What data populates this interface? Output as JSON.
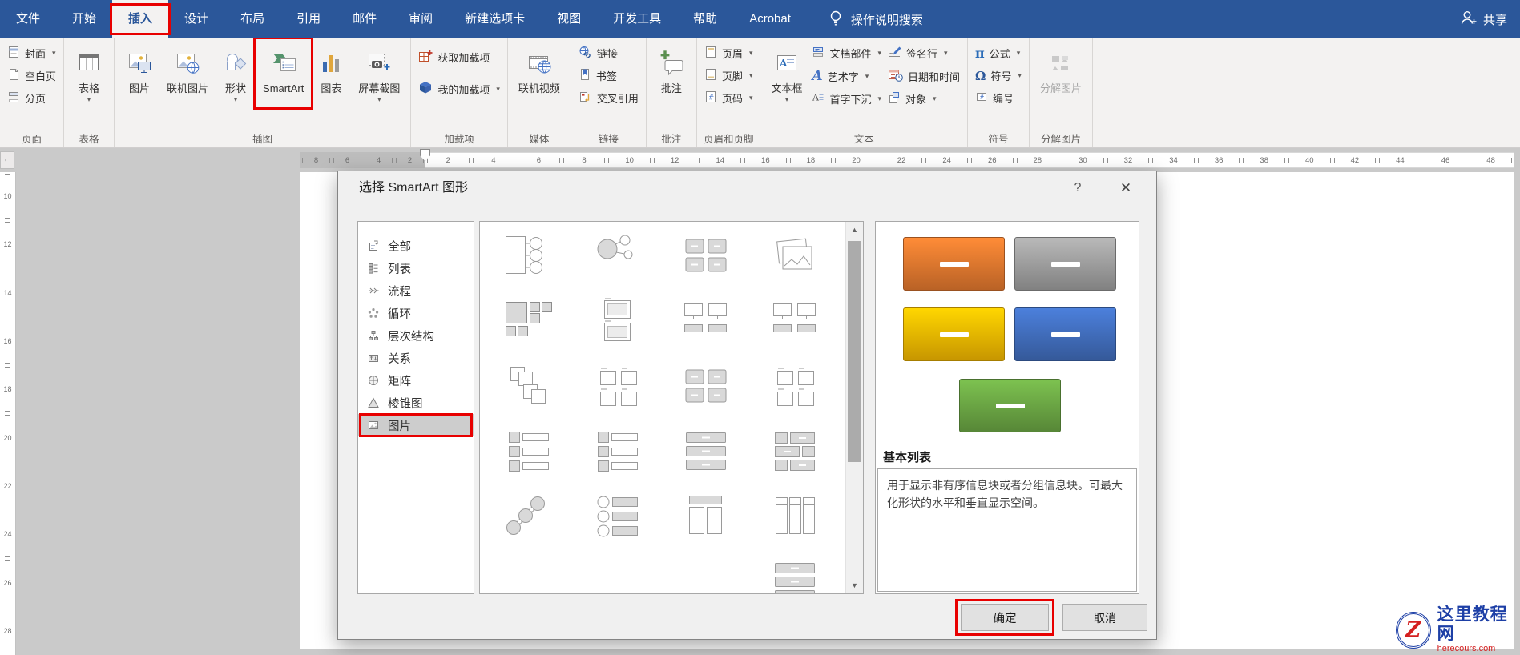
{
  "titlebar": {
    "tabs": [
      "文件",
      "开始",
      "插入",
      "设计",
      "布局",
      "引用",
      "邮件",
      "审阅",
      "新建选项卡",
      "视图",
      "开发工具",
      "帮助",
      "Acrobat"
    ],
    "active_tab": "插入",
    "search_label": "操作说明搜索",
    "share_label": "共享"
  },
  "ribbon": {
    "groups": [
      {
        "label": "页面",
        "blocks": [
          {
            "type": "stack",
            "items": [
              {
                "label": "封面",
                "icon": "cover-icon",
                "dd": true
              },
              {
                "label": "空白页",
                "icon": "blank-page-icon"
              },
              {
                "label": "分页",
                "icon": "page-break-icon"
              }
            ]
          }
        ]
      },
      {
        "label": "表格",
        "blocks": [
          {
            "type": "big",
            "items": [
              {
                "label": "表格",
                "icon": "table-icon",
                "dd": true
              }
            ]
          }
        ]
      },
      {
        "label": "插图",
        "blocks": [
          {
            "type": "big",
            "items": [
              {
                "label": "图片",
                "icon": "picture-icon"
              },
              {
                "label": "联机图片",
                "icon": "online-pictures-icon"
              },
              {
                "label": "形状",
                "icon": "shapes-icon",
                "dd": true
              },
              {
                "label": "SmartArt",
                "icon": "smartart-icon",
                "highlight": true
              },
              {
                "label": "图表",
                "icon": "chart-icon"
              },
              {
                "label": "屏幕截图",
                "icon": "screenshot-icon",
                "dd": true
              }
            ]
          }
        ]
      },
      {
        "label": "加载项",
        "blocks": [
          {
            "type": "stack",
            "loose": true,
            "items": [
              {
                "label": "获取加载项",
                "icon": "store-icon"
              },
              {
                "label": "我的加载项",
                "icon": "my-addins-icon",
                "dd": true
              }
            ]
          }
        ]
      },
      {
        "label": "媒体",
        "blocks": [
          {
            "type": "big",
            "items": [
              {
                "label": "联机视频",
                "icon": "online-video-icon"
              }
            ]
          }
        ]
      },
      {
        "label": "链接",
        "blocks": [
          {
            "type": "stack",
            "items": [
              {
                "label": "链接",
                "icon": "link-icon"
              },
              {
                "label": "书签",
                "icon": "bookmark-icon"
              },
              {
                "label": "交叉引用",
                "icon": "cross-reference-icon"
              }
            ]
          }
        ]
      },
      {
        "label": "批注",
        "blocks": [
          {
            "type": "big",
            "items": [
              {
                "label": "批注",
                "icon": "comment-icon"
              }
            ]
          }
        ]
      },
      {
        "label": "页眉和页脚",
        "blocks": [
          {
            "type": "stack",
            "items": [
              {
                "label": "页眉",
                "icon": "header-icon",
                "dd": true
              },
              {
                "label": "页脚",
                "icon": "footer-icon",
                "dd": true
              },
              {
                "label": "页码",
                "icon": "page-number-icon",
                "dd": true
              }
            ]
          }
        ]
      },
      {
        "label": "文本",
        "blocks": [
          {
            "type": "big",
            "items": [
              {
                "label": "文本框",
                "icon": "textbox-icon",
                "dd": true
              }
            ]
          },
          {
            "type": "stack",
            "items": [
              {
                "label": "文档部件",
                "icon": "quick-parts-icon",
                "dd": true
              },
              {
                "label": "艺术字",
                "icon": "wordart-icon",
                "dd": true
              },
              {
                "label": "首字下沉",
                "icon": "drop-cap-icon",
                "dd": true
              }
            ]
          },
          {
            "type": "stack",
            "items": [
              {
                "label": "签名行",
                "icon": "signature-line-icon",
                "dd": true
              },
              {
                "label": "日期和时间",
                "icon": "date-time-icon"
              },
              {
                "label": "对象",
                "icon": "object-icon",
                "dd": true
              }
            ]
          }
        ]
      },
      {
        "label": "符号",
        "blocks": [
          {
            "type": "stack",
            "items": [
              {
                "label": "公式",
                "icon": "equation-icon",
                "dd": true
              },
              {
                "label": "符号",
                "icon": "symbol-icon",
                "dd": true
              },
              {
                "label": "编号",
                "icon": "numbering-icon"
              }
            ]
          }
        ]
      },
      {
        "label": "分解图片",
        "blocks": [
          {
            "type": "big",
            "items": [
              {
                "label": "分解图片",
                "icon": "decompose-picture-icon",
                "disabled": true
              }
            ]
          }
        ]
      }
    ]
  },
  "ruler": {
    "h_margin_labels": [
      "8",
      "6",
      "4",
      "2"
    ],
    "h_labels": [
      "2",
      "4",
      "6",
      "8",
      "10",
      "12",
      "14",
      "16",
      "18",
      "20",
      "22",
      "24",
      "26",
      "28",
      "30",
      "32",
      "34",
      "36",
      "38",
      "40",
      "42",
      "44",
      "46",
      "48"
    ],
    "v_labels": [
      "10",
      "12",
      "14",
      "16",
      "18",
      "20",
      "22",
      "24",
      "26",
      "28"
    ]
  },
  "dialog": {
    "title": "选择 SmartArt 图形",
    "help_glyph": "?",
    "close_glyph": "✕",
    "categories": [
      {
        "label": "全部",
        "icon": "all-icon"
      },
      {
        "label": "列表",
        "icon": "list-category-icon"
      },
      {
        "label": "流程",
        "icon": "process-icon"
      },
      {
        "label": "循环",
        "icon": "cycle-icon"
      },
      {
        "label": "层次结构",
        "icon": "hierarchy-icon"
      },
      {
        "label": "关系",
        "icon": "relationship-icon"
      },
      {
        "label": "矩阵",
        "icon": "matrix-icon"
      },
      {
        "label": "棱锥图",
        "icon": "pyramid-icon"
      },
      {
        "label": "图片",
        "icon": "picture-category-icon",
        "selected": true,
        "highlight": true
      }
    ],
    "gallery_items": [
      "thumb-vertical-picture-list",
      "thumb-alternating-picture-circles",
      "thumb-picture-blocks",
      "thumb-stacked-pictures",
      "thumb-bending-picture-grid",
      "thumb-framed-pictures",
      "thumb-picture-screens",
      "thumb-picture-screens",
      "thumb-overlapping-pictures",
      "thumb-titled-pictures",
      "thumb-picture-blocks",
      "thumb-titled-pictures",
      "thumb-picture-caption-rows",
      "thumb-picture-caption-rows",
      "thumb-horizontal-bars",
      "thumb-bento-grid",
      "thumb-ascending-circles",
      "thumb-circle-caption-rows",
      "thumb-header-columns",
      "thumb-three-columns",
      "thumb-hex-partial",
      "thumb-dot-link-partial",
      "thumb-dot-link-partial",
      "thumb-horizontal-bars"
    ],
    "preview": {
      "shapes": [
        {
          "name": "orange",
          "color": "#ED7D31"
        },
        {
          "name": "gray",
          "color": "#A5A5A5"
        },
        {
          "name": "gold",
          "color": "#FFC000"
        },
        {
          "name": "blue",
          "color": "#4472C4"
        },
        {
          "name": "green",
          "color": "#70AD47"
        }
      ],
      "name": "基本列表",
      "description": "用于显示非有序信息块或者分组信息块。可最大化形状的水平和垂直显示空间。"
    },
    "ok_label": "确定",
    "cancel_label": "取消"
  },
  "watermark": {
    "logo_glyph": "Z",
    "site_name": "这里教程网",
    "site_url": "herecours.com"
  },
  "colors": {
    "titlebar": "#2b579a",
    "highlight_red": "#e80000"
  }
}
